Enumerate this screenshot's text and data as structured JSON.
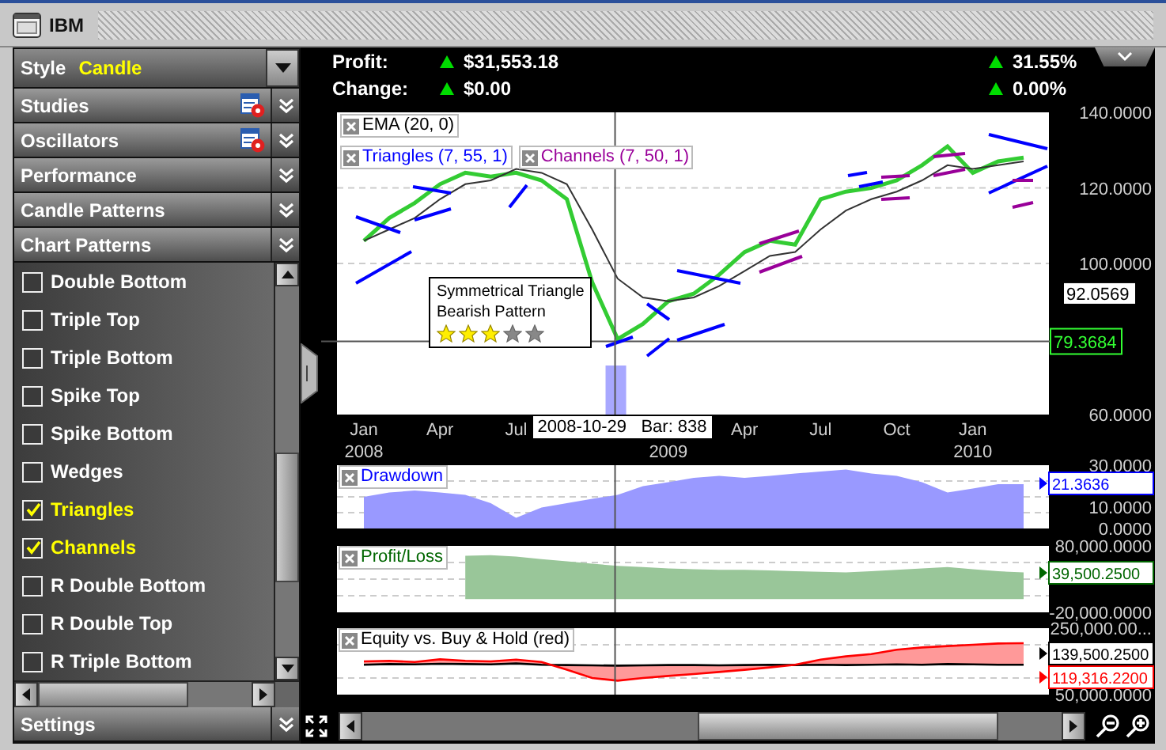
{
  "window": {
    "title": "IBM"
  },
  "sidebar": {
    "style": {
      "label": "Style",
      "value": "Candle"
    },
    "sections": [
      {
        "label": "Studies",
        "kind": "with-settings"
      },
      {
        "label": "Oscillators",
        "kind": "with-settings"
      },
      {
        "label": "Performance",
        "kind": "plain"
      },
      {
        "label": "Candle Patterns",
        "kind": "plain"
      },
      {
        "label": "Chart Patterns",
        "kind": "plain"
      }
    ],
    "chart_patterns": [
      {
        "label": "Double Bottom",
        "checked": false
      },
      {
        "label": "Triple Top",
        "checked": false
      },
      {
        "label": "Triple Bottom",
        "checked": false
      },
      {
        "label": "Spike Top",
        "checked": false
      },
      {
        "label": "Spike Bottom",
        "checked": false
      },
      {
        "label": "Wedges",
        "checked": false
      },
      {
        "label": "Triangles",
        "checked": true
      },
      {
        "label": "Channels",
        "checked": true
      },
      {
        "label": "R Double Bottom",
        "checked": false
      },
      {
        "label": "R Double Top",
        "checked": false
      },
      {
        "label": "R Triple Bottom",
        "checked": false
      }
    ],
    "footer_section": {
      "label": "Settings"
    }
  },
  "summary": [
    {
      "label": "Profit:",
      "value": "$31,553.18",
      "percent": "31.55%"
    },
    {
      "label": "Change:",
      "value": "$0.00",
      "percent": "0.00%"
    }
  ],
  "main_chart": {
    "legends": [
      {
        "label": "EMA (20, 0)",
        "color": "#000000"
      },
      {
        "label": "Triangles (7, 55, 1)",
        "color": "#0000ff"
      },
      {
        "label": "Channels (7, 50, 1)",
        "color": "#990099"
      }
    ],
    "tooltip": {
      "title": "Symmetrical Triangle",
      "subtitle": "Bearish Pattern",
      "stars": 3
    },
    "year_labels": [
      {
        "label": "2008"
      },
      {
        "label": "2009"
      },
      {
        "label": "2010"
      }
    ],
    "value_label": "92.0569",
    "crosshair": {
      "date_label": "2008-10-29   Bar: 838"
    },
    "chart_data": {
      "type": "line",
      "categories": [
        "Jan",
        null,
        null,
        "Apr",
        null,
        null,
        "Jul",
        null,
        null,
        null,
        null,
        null,
        null,
        null,
        null,
        "Apr",
        null,
        null,
        "Jul",
        null,
        null,
        "Oct",
        null,
        null,
        "Jan",
        null,
        null
      ],
      "series": [
        {
          "color": "#33cc33",
          "values": [
            106,
            112,
            116,
            121,
            124,
            123,
            124,
            122,
            117,
            95,
            80,
            84,
            90,
            92,
            97,
            103,
            106,
            105,
            117,
            119,
            120,
            122,
            126,
            131,
            124,
            127,
            128
          ]
        },
        {
          "color": "#333333",
          "values": [
            106,
            109,
            112,
            117,
            121,
            122,
            125,
            124,
            121,
            109,
            96,
            91,
            90,
            91,
            94,
            98,
            102,
            103,
            109,
            114,
            117,
            119,
            122,
            126,
            125,
            126,
            127
          ]
        }
      ],
      "ylim": [
        60,
        140
      ],
      "yticks": [
        {
          "value": 60,
          "label": "60.0000"
        },
        {
          "value": 100,
          "label": "100.0000"
        },
        {
          "value": 120,
          "label": "120.0000"
        },
        {
          "value": 140,
          "label": "140.0000"
        }
      ],
      "ref_lines": [
        {
          "axis": "y",
          "value": 79.3684,
          "label": "79.3684"
        }
      ]
    }
  },
  "indicator_panels": [
    {
      "title": "Drawdown",
      "color": "#0000ff",
      "value_labels": [
        {
          "label": "21.3636",
          "color": "#0000ff"
        }
      ],
      "chart_data": {
        "type": "area",
        "categories": [
          null,
          null,
          null,
          null,
          null,
          null,
          null,
          null,
          null,
          null,
          null,
          null,
          null,
          null,
          null,
          null,
          null,
          null,
          null,
          null,
          null,
          null,
          null,
          null,
          null,
          null,
          null
        ],
        "series": [
          {
            "color": "#9999ff",
            "values": [
              15,
              17,
              18,
              17,
              16,
              12,
              5,
              10,
              12,
              14,
              16,
              20,
              22,
              24,
              25,
              24,
              25,
              26,
              27,
              28,
              26,
              25,
              22,
              17,
              19,
              21,
              21
            ]
          }
        ],
        "ylim": [
          0,
          30
        ],
        "yticks": [
          {
            "value": 0,
            "label": "0.0000"
          },
          {
            "value": 10,
            "label": "10.0000"
          },
          {
            "value": 30,
            "label": "30.0000"
          }
        ]
      }
    },
    {
      "title": "Profit/Loss",
      "color": "#006600",
      "value_labels": [
        {
          "label": "39,500.2500",
          "color": "#006600"
        }
      ],
      "chart_data": {
        "type": "area",
        "categories": [
          null,
          null,
          null,
          null,
          null,
          null,
          null,
          null,
          null,
          null,
          null,
          null,
          null,
          null,
          null,
          null,
          null,
          null,
          null,
          null,
          null,
          null,
          null,
          null,
          null,
          null,
          null
        ],
        "series": [
          {
            "color": "#99c699",
            "values": [
              null,
              null,
              null,
              null,
              65000,
              66000,
              64000,
              60000,
              57000,
              53000,
              50000,
              48000,
              46000,
              45000,
              44000,
              44000,
              43000,
              42000,
              41000,
              40000,
              42000,
              44000,
              46000,
              48000,
              45000,
              42000,
              40000
            ]
          }
        ],
        "ylim": [
          -20000,
          80000
        ],
        "yticks": [
          {
            "value": 80000,
            "label": "80,000.0000"
          },
          {
            "value": -20000,
            "label": "-20,000.0000"
          }
        ]
      }
    },
    {
      "title": "Equity vs. Buy & Hold (red)",
      "color": "#000000",
      "value_labels": [
        {
          "label": "139,500.2500",
          "color": "#000000"
        },
        {
          "label": "119,316.2200",
          "color": "#ff0000"
        }
      ],
      "axis_labels": [
        {
          "label": "250,000.00..."
        },
        {
          "label": "50,000.0000"
        }
      ]
    }
  ]
}
